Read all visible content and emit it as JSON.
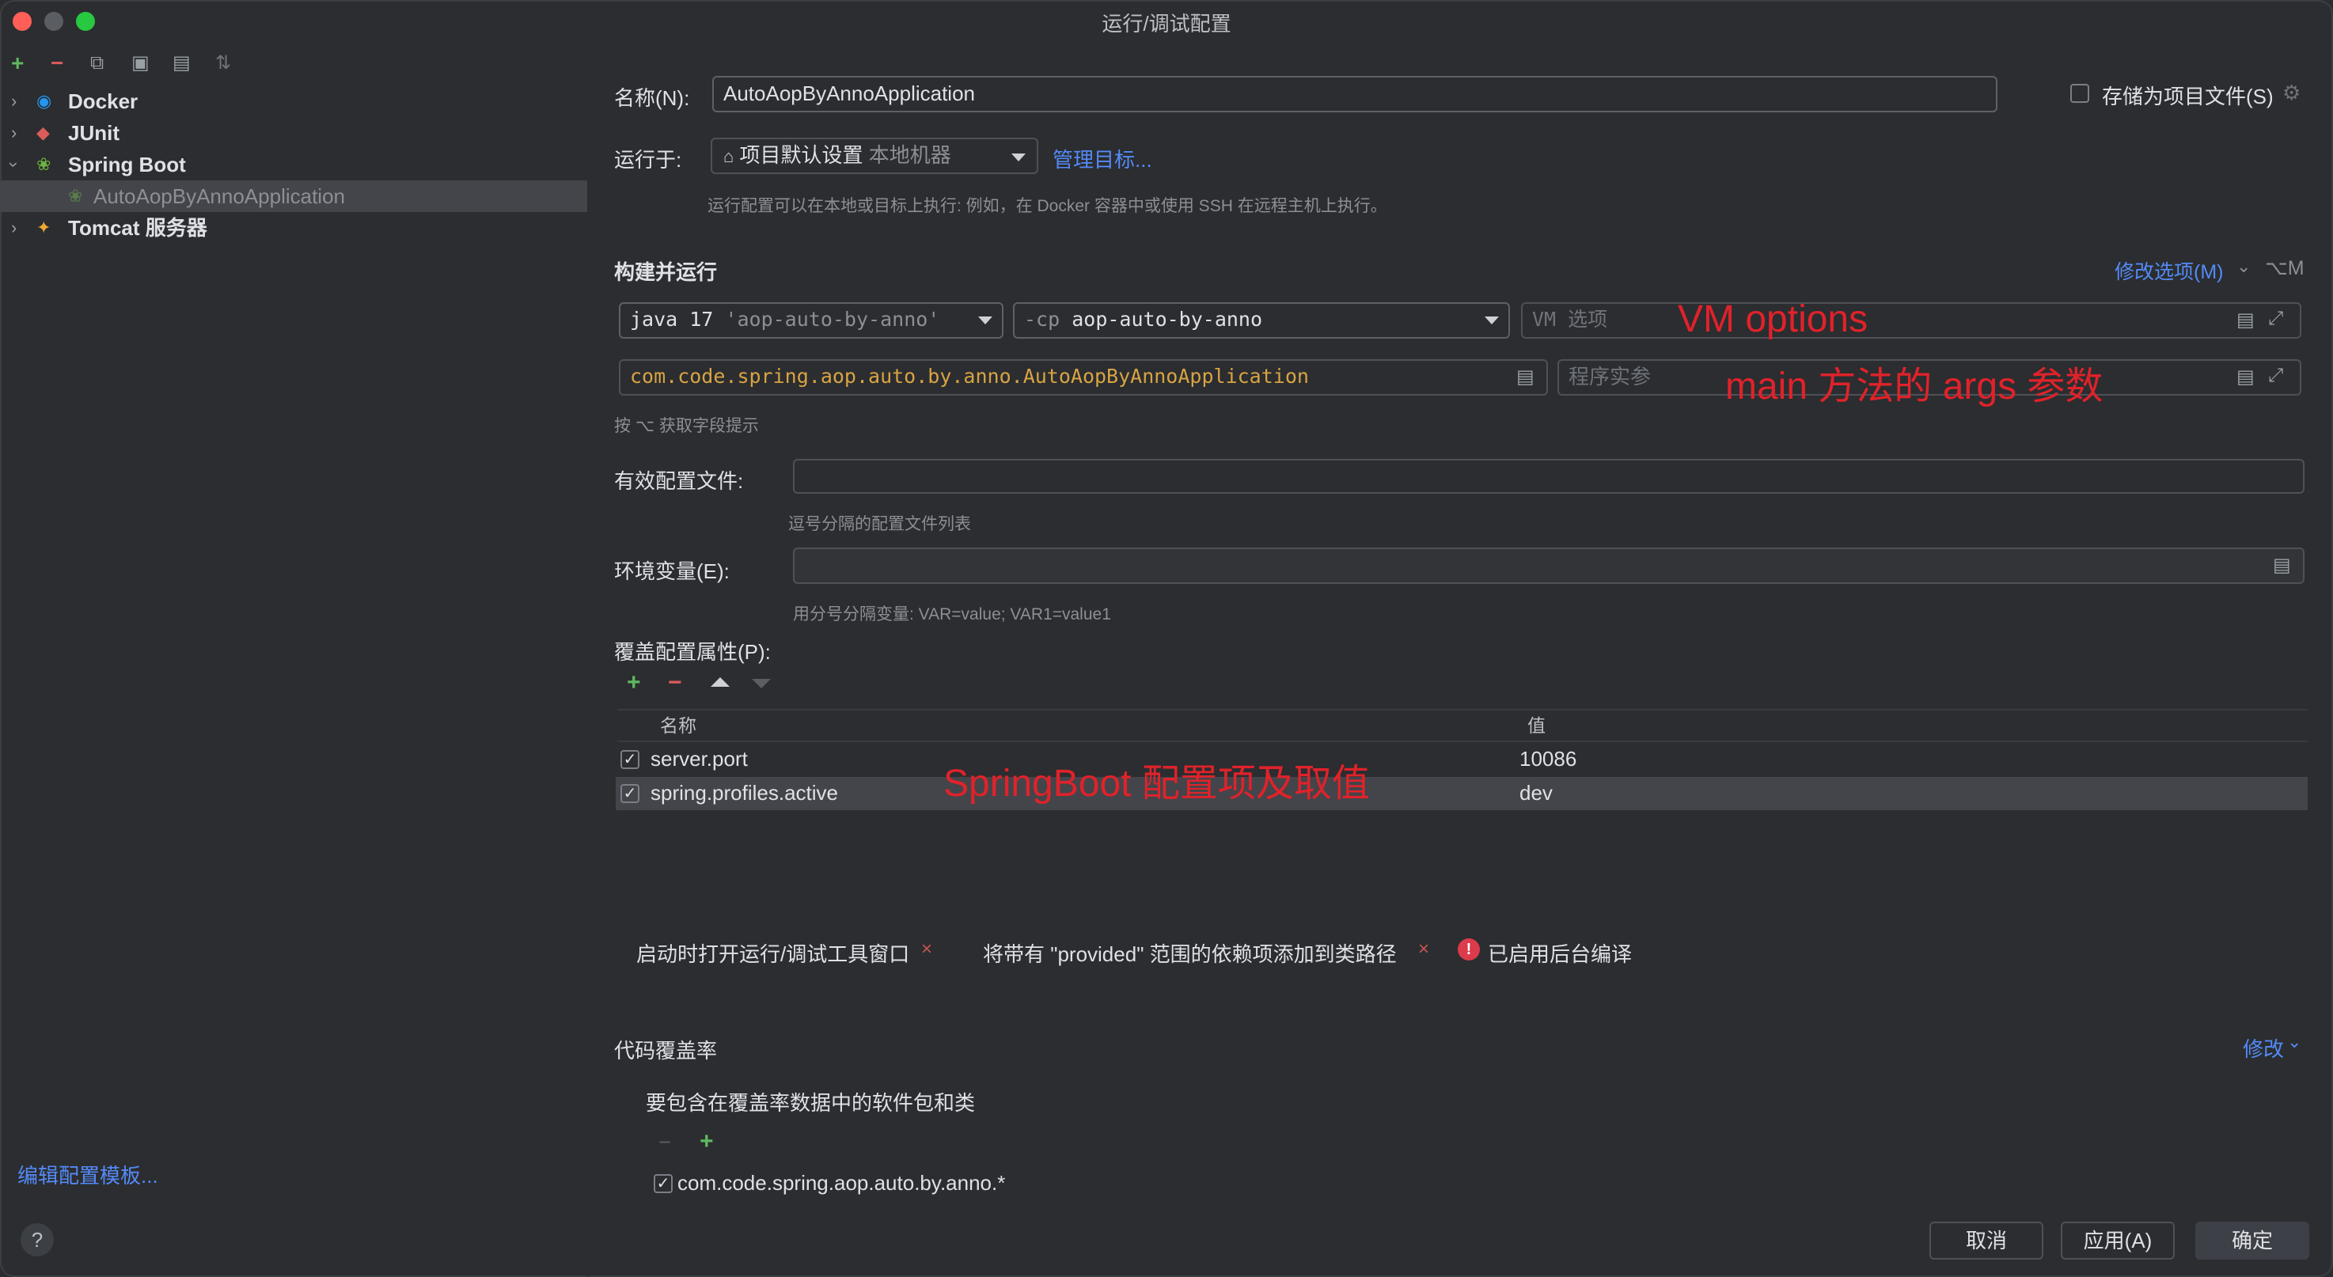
{
  "window": {
    "title": "运行/调试配置"
  },
  "left_panel": {
    "toolbar_icons": [
      "add-icon",
      "remove-icon",
      "copy-icon",
      "save-icon",
      "folder-icon",
      "sort-icon"
    ],
    "tree": [
      {
        "label": "Docker",
        "icon": "docker-icon",
        "expanded": false
      },
      {
        "label": "JUnit",
        "icon": "junit-icon",
        "expanded": false
      },
      {
        "label": "Spring Boot",
        "icon": "spring-boot-icon",
        "expanded": true
      },
      {
        "label": "AutoAopByAnnoApplication",
        "icon": "spring-app-icon",
        "selected": true
      },
      {
        "label": "Tomcat 服务器",
        "icon": "tomcat-icon",
        "expanded": false
      }
    ],
    "edit_templates_link": "编辑配置模板..."
  },
  "form": {
    "name_label": "名称(N):",
    "name_value": "AutoAopByAnnoApplication",
    "store_as_file_label": "存储为项目文件(S)",
    "run_on_label": "运行于:",
    "run_on_value": "项目默认设置",
    "run_on_sub": "本地机器",
    "manage_targets_link": "管理目标...",
    "run_on_hint": "运行配置可以在本地或目标上执行: 例如，在 Docker 容器中或使用 SSH 在远程主机上执行。",
    "build_run_title": "构建并运行",
    "modify_options_link": "修改选项(M)",
    "modify_options_shortcut": "⌥M",
    "java_select": "java 17",
    "java_select_sub": "'aop-auto-by-anno'",
    "cp_prefix": "-cp",
    "cp_value": "aop-auto-by-anno",
    "vm_options_placeholder": "VM 选项",
    "main_class_value": "com.code.spring.aop.auto.by.anno.AutoAopByAnnoApplication",
    "program_args_placeholder": "程序实参",
    "field_hint": "按 ⌥ 获取字段提示",
    "active_profiles_label": "有效配置文件:",
    "active_profiles_value": "",
    "active_profiles_hint": "逗号分隔的配置文件列表",
    "env_label": "环境变量(E):",
    "env_value": "",
    "env_hint": "用分号分隔变量: VAR=value; VAR1=value1",
    "override_label": "覆盖配置属性(P):",
    "override_table": {
      "columns": [
        "名称",
        "值"
      ],
      "rows": [
        {
          "checked": true,
          "name": "server.port",
          "value": "10086",
          "selected": false
        },
        {
          "checked": true,
          "name": "spring.profiles.active",
          "value": "dev",
          "selected": true
        }
      ]
    },
    "option_chips": [
      {
        "label": "启动时打开运行/调试工具窗口",
        "removable": true
      },
      {
        "label": "将带有 \"provided\" 范围的依赖项添加到类路径",
        "removable": true
      },
      {
        "label": "已启用后台编译",
        "warning": true
      }
    ],
    "coverage_title": "代码覆盖率",
    "coverage_modify_link": "修改",
    "coverage_include_label": "要包含在覆盖率数据中的软件包和类",
    "coverage_entries": [
      {
        "checked": true,
        "pattern": "com.code.spring.aop.auto.by.anno.*"
      }
    ]
  },
  "annotations": {
    "vm_options": "VM options",
    "main_args": "main 方法的 args 参数",
    "springboot_props": "SpringBoot 配置项及取值"
  },
  "buttons": {
    "cancel": "取消",
    "apply": "应用(A)",
    "ok": "确定"
  },
  "colors": {
    "accent": "#3574f0",
    "link": "#548af7",
    "annotation": "#e0222a",
    "background": "#2b2d30"
  }
}
